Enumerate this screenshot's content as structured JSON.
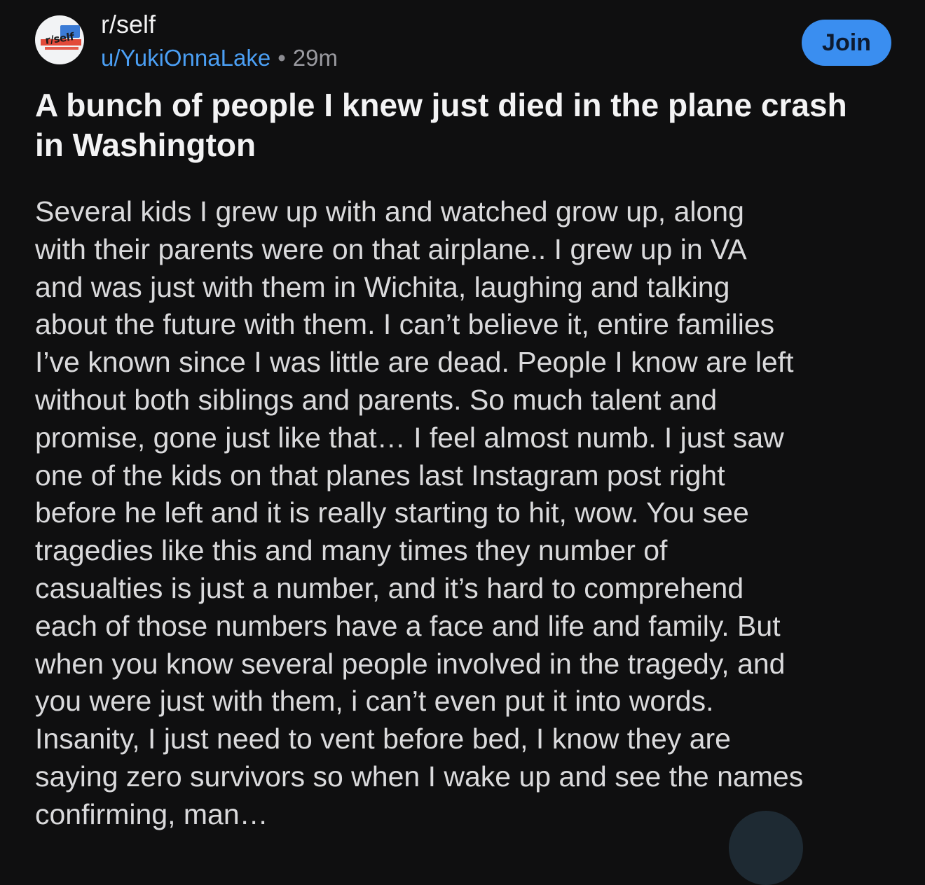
{
  "post": {
    "community": {
      "avatar_label": "r/self",
      "name": "r/self"
    },
    "author": "u/YukiOnnaLake",
    "separator": "•",
    "time_ago": "29m",
    "join_label": "Join",
    "title": "A bunch of people I knew just died in the plane crash in Washington",
    "body_lines": [
      "Several kids I grew up with and watched grow up, along",
      "with their parents were on that airplane.. I grew up in VA",
      "and was just with them in Wichita, laughing and talking",
      "about the future with them. I can’t believe it, entire families",
      "I’ve known since I was little are dead. People I know are left",
      "without both siblings and parents. So much talent and",
      "promise, gone just like that… I feel almost numb. I just saw",
      "one of the kids on that planes last Instagram post right",
      "before he left and it is really starting to hit, wow. You see",
      "tragedies like this and many times they number of",
      "casualties is just a number, and it’s hard to comprehend",
      "each of those numbers have a face and life and family. But",
      "when you know several people involved in the tragedy, and",
      "you were just with them, i can’t even put it into words.",
      "Insanity, I just need to vent before bed, I know they are",
      "saying zero survivors so when I wake up and see the names",
      "confirming, man…"
    ]
  },
  "colors": {
    "background": "#0f0f10",
    "link_blue": "#4b9ff4",
    "join_button": "#3a8ef0"
  }
}
